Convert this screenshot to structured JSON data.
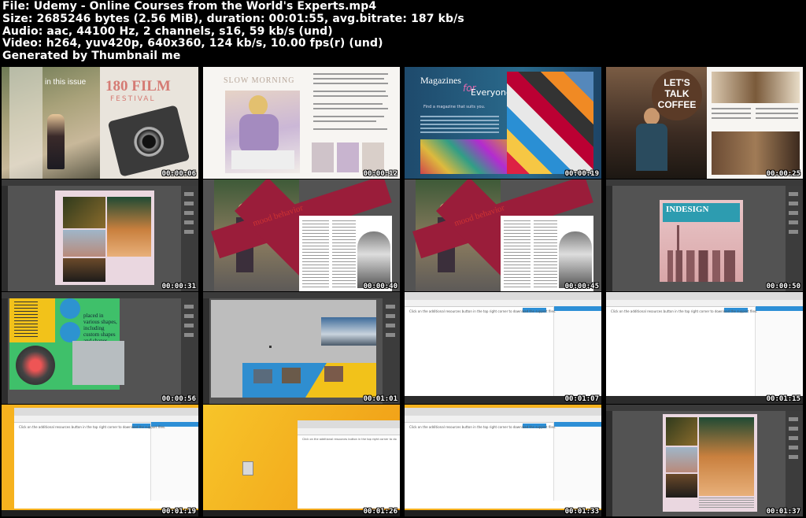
{
  "header": {
    "file_line": "File: Udemy - Online Courses from the World's Experts.mp4",
    "size_line": "Size: 2685246 bytes (2.56 MiB), duration: 00:01:55, avg.bitrate: 187 kb/s",
    "audio_line": "Audio: aac, 44100 Hz, 2 channels, s16, 59 kb/s (und)",
    "video_line": "Video: h264, yuv420p, 640x360, 124 kb/s, 10.00 fps(r) (und)",
    "generated_line": "Generated by Thumbnail me"
  },
  "thumbnails": [
    {
      "timestamp": "00:00:06",
      "texts": {
        "a": "in this issue",
        "b": "180 FILM",
        "c": "FESTIVAL"
      }
    },
    {
      "timestamp": "00:00:12",
      "texts": {
        "a": "SLOW MORNING"
      }
    },
    {
      "timestamp": "00:00:19",
      "texts": {
        "a": "Magazines",
        "b": "for",
        "c": "Everyone",
        "d": "Find a magazine that suits you."
      }
    },
    {
      "timestamp": "00:00:25",
      "texts": {
        "a": "LET'S",
        "b": "TALK",
        "c": "COFFEE"
      }
    },
    {
      "timestamp": "00:00:31"
    },
    {
      "timestamp": "00:00:40",
      "texts": {
        "a": "mood behavior"
      }
    },
    {
      "timestamp": "00:00:45",
      "texts": {
        "a": "mood behavior"
      }
    },
    {
      "timestamp": "00:00:50",
      "texts": {
        "a": "INDESIGN"
      }
    },
    {
      "timestamp": "00:00:56",
      "texts": {
        "a": "placed in various shapes, including custom shapes and shapes drawn with the Pen tool."
      }
    },
    {
      "timestamp": "00:01:01"
    },
    {
      "timestamp": "00:01:07",
      "texts": {
        "msg": "Click on the additional resources button in the top right corner to download the support files."
      }
    },
    {
      "timestamp": "00:01:15",
      "texts": {
        "msg": "Click on the additional resources button in the top right corner to download the support files."
      }
    },
    {
      "timestamp": "00:01:19",
      "texts": {
        "msg": "Click on the additional resources button in the top right corner to download the support files."
      }
    },
    {
      "timestamp": "00:01:26",
      "texts": {
        "msg": "Click on the additional resources button in the top right corner to do"
      }
    },
    {
      "timestamp": "00:01:33",
      "texts": {
        "msg": "Click on the additional resources button in the top right corner to download the support files."
      }
    },
    {
      "timestamp": "00:01:37"
    }
  ]
}
